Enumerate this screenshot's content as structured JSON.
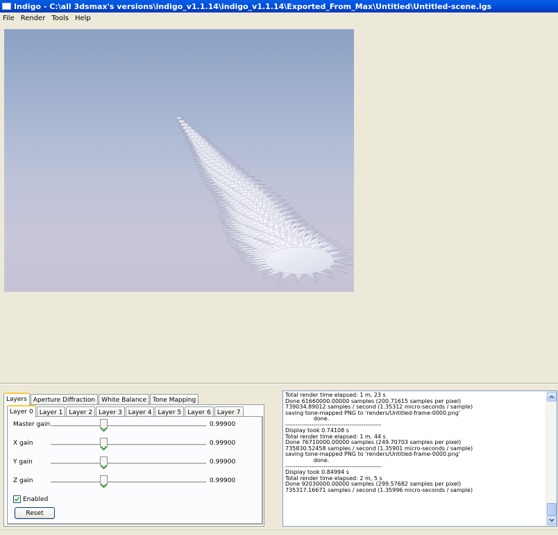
{
  "window": {
    "title": "Indigo - C:\\all 3dsmax's versions\\indigo_v1.1.14\\indigo_v1.1.14\\Exported_From_Max\\Untitled\\Untitled-scene.igs"
  },
  "menu": [
    {
      "label": "File"
    },
    {
      "label": "Render"
    },
    {
      "label": "Tools"
    },
    {
      "label": "Help"
    }
  ],
  "panel": {
    "tabs": [
      {
        "label": "Layers"
      },
      {
        "label": "Aperture Diffraction"
      },
      {
        "label": "White Balance"
      },
      {
        "label": "Tone Mapping"
      }
    ],
    "layer_tabs": [
      {
        "label": "Layer 0"
      },
      {
        "label": "Layer 1"
      },
      {
        "label": "Layer 2"
      },
      {
        "label": "Layer 3"
      },
      {
        "label": "Layer 4"
      },
      {
        "label": "Layer 5"
      },
      {
        "label": "Layer 6"
      },
      {
        "label": "Layer 7"
      }
    ],
    "sliders": [
      {
        "label": "Master gain",
        "value": "0.99900",
        "level": 0.34
      },
      {
        "label": "X gain",
        "value": "0.99900",
        "level": 0.34
      },
      {
        "label": "Y gain",
        "value": "0.99900",
        "level": 0.34
      },
      {
        "label": "Z gain",
        "value": "0.99900",
        "level": 0.34
      }
    ],
    "enabled_label": "Enabled",
    "enabled_checked": true,
    "reset_label": "Reset"
  },
  "log": {
    "lines": [
      "Total render time elapsed: 1 m, 23 s",
      "Done 61660000.00000 samples (200.71615 samples per pixel)",
      "739034.89012 samples / second (1.35312 micro-seconds / sample)",
      "saving tone-mapped PNG to 'renders/Untitled-frame-0000.png'",
      "                done.",
      "------------------------------------------------",
      "Display took 0.74108 s",
      "Total render time elapsed: 1 m, 44 s",
      "Done 76710000.00000 samples (249.70703 samples per pixel)",
      "735830.52458 samples / second (1.35901 micro-seconds / sample)",
      "saving tone-mapped PNG to 'renders/Untitled-frame-0000.png'",
      "                done.",
      "------------------------------------------------",
      "Display took 0.84994 s",
      "Total render time elapsed: 2 m, 5 s",
      "Done 92030000.00000 samples (299.57682 samples per pixel)",
      "735317.16671 samples / second (1.35996 micro-seconds / sample)"
    ]
  },
  "icons": {
    "scroll_up": "chevron-up-icon",
    "scroll_down": "chevron-down-icon",
    "check": "check-icon",
    "app": "window-icon"
  },
  "colors": {
    "titlebar": "#0055e5",
    "tab_highlight": "#ffc83c",
    "slider_thumb": "#21a121",
    "face": "#ece9d8"
  }
}
